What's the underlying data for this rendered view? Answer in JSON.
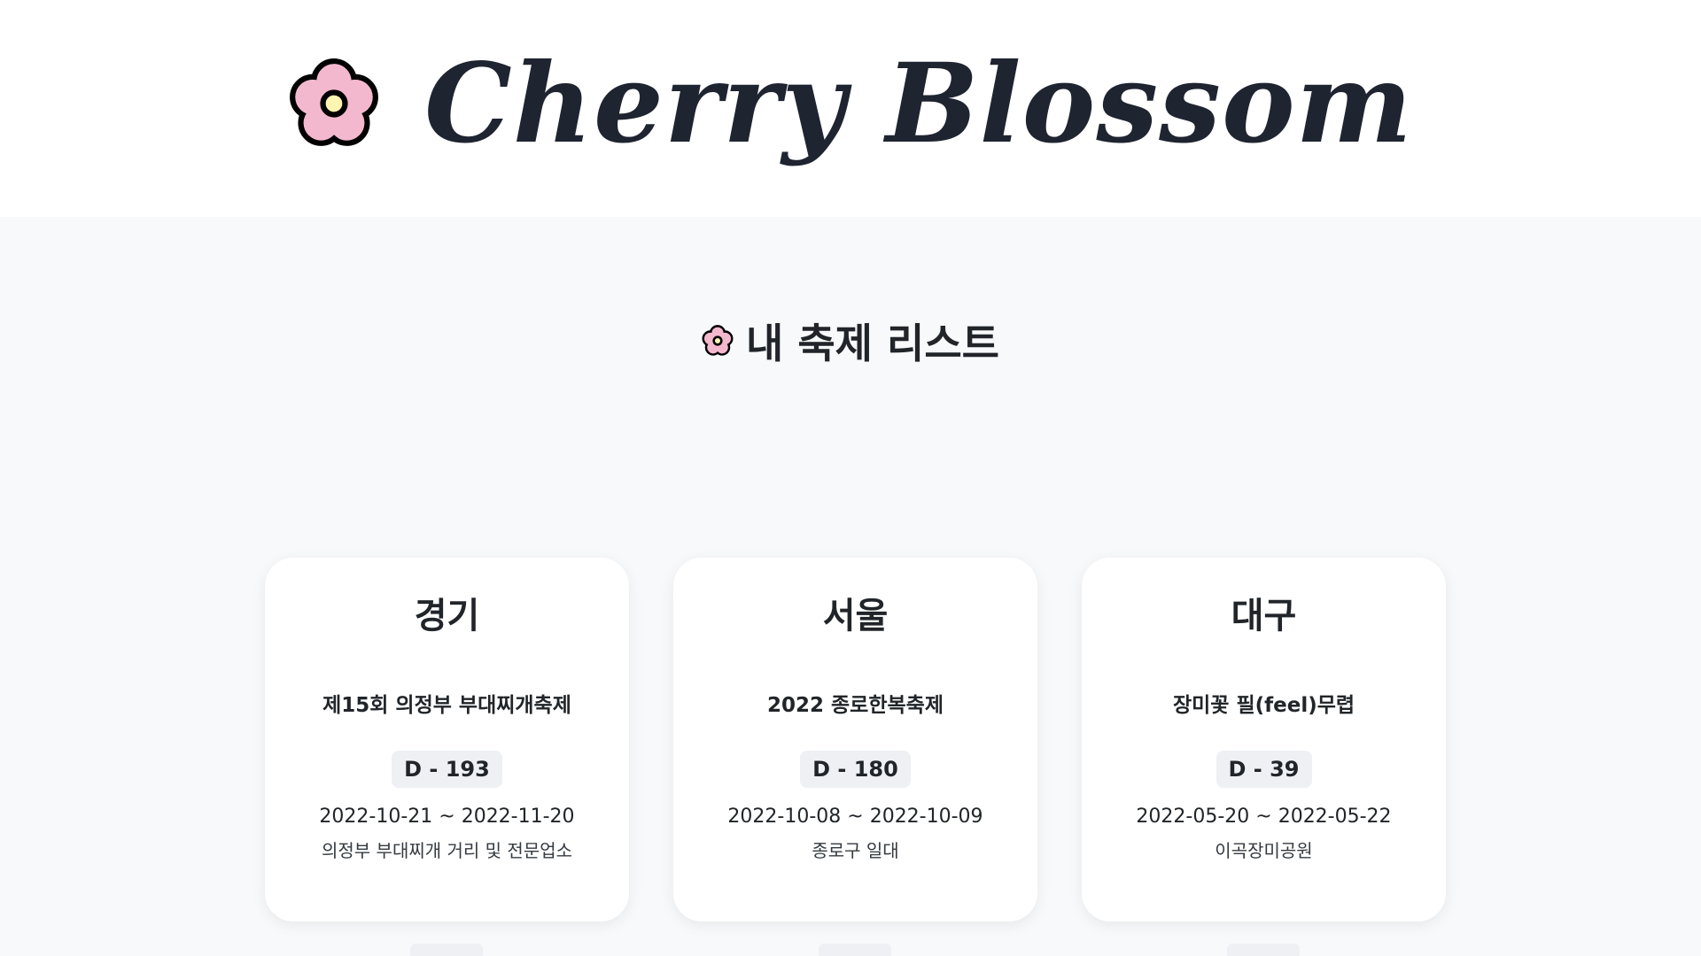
{
  "header": {
    "logo_text": "Cherry Blossom",
    "logo_icon": "flower-icon"
  },
  "section": {
    "title": "내 축제 리스트",
    "title_icon": "flower-icon"
  },
  "cards": [
    {
      "region": "경기",
      "name": "제15회 의정부 부대찌개축제",
      "dday": "D - 193",
      "dates": "2022-10-21 ~ 2022-11-20",
      "place": "의정부 부대찌개 거리 및 전문업소"
    },
    {
      "region": "서울",
      "name": "2022 종로한복축제",
      "dday": "D - 180",
      "dates": "2022-10-08 ~ 2022-10-09",
      "place": "종로구 일대"
    },
    {
      "region": "대구",
      "name": "장미꽃 필(feel)무렵",
      "dday": "D - 39",
      "dates": "2022-05-20 ~ 2022-05-22",
      "place": "이곡장미공원"
    }
  ],
  "colors": {
    "background": "#f8f9fa",
    "header_bg": "#ffffff",
    "text": "#1e2430",
    "petal": "#f4b8ce",
    "center": "#fff5b0",
    "badge_bg": "#eef0f3"
  }
}
